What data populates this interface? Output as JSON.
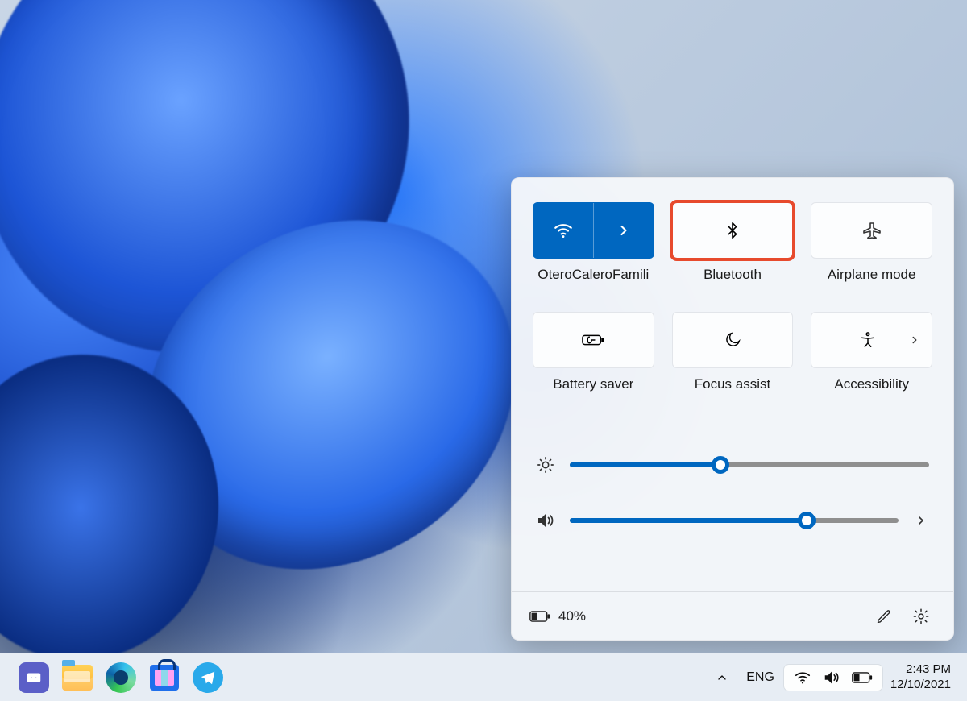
{
  "panel": {
    "tiles": [
      {
        "id": "wifi",
        "label": "OteroCaleroFamili",
        "active": true,
        "hasExpand": true,
        "highlight": false
      },
      {
        "id": "bluetooth",
        "label": "Bluetooth",
        "active": false,
        "hasExpand": false,
        "highlight": true
      },
      {
        "id": "airplane",
        "label": "Airplane mode",
        "active": false,
        "hasExpand": false,
        "highlight": false
      },
      {
        "id": "battery-saver",
        "label": "Battery saver",
        "active": false,
        "hasExpand": false,
        "highlight": false
      },
      {
        "id": "focus-assist",
        "label": "Focus assist",
        "active": false,
        "hasExpand": false,
        "highlight": false
      },
      {
        "id": "accessibility",
        "label": "Accessibility",
        "active": false,
        "hasExpand": true,
        "highlight": false
      }
    ],
    "brightness_percent": 42,
    "volume_percent": 72,
    "footer": {
      "battery_text": "40%"
    }
  },
  "taskbar": {
    "language": "ENG",
    "time": "2:43 PM",
    "date": "12/10/2021"
  }
}
